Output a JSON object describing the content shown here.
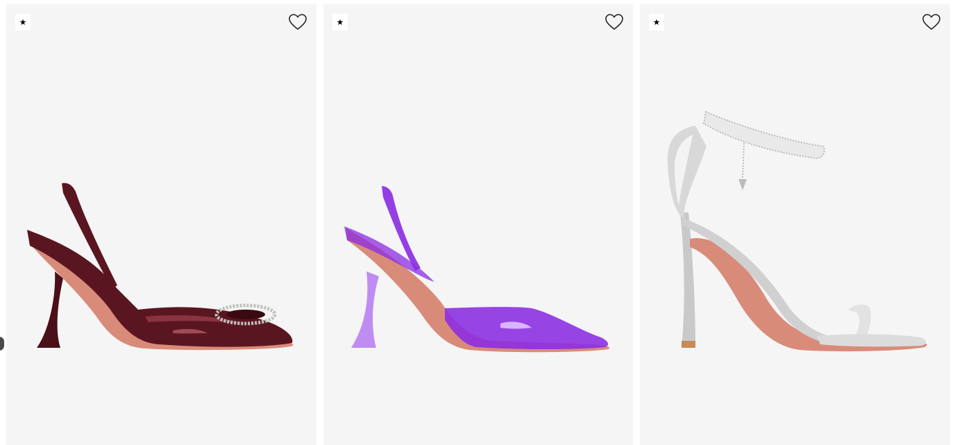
{
  "products": [
    {
      "badge_icon": "star-icon",
      "badge_text": "★",
      "wishlist_icon": "heart-outline-icon",
      "image": "burgundy-slingback-pump-with-crystal-buckle",
      "colors": {
        "upper": "#5a1620",
        "highlight": "#8a3440",
        "sole": "#d98b7a"
      }
    },
    {
      "badge_icon": "star-icon",
      "badge_text": "★",
      "wishlist_icon": "heart-outline-icon",
      "image": "purple-pvc-slingback-pump",
      "colors": {
        "upper": "#8a2be2",
        "highlight": "#b57af0",
        "sole": "#d98b7a"
      }
    },
    {
      "badge_icon": "star-icon",
      "badge_text": "★",
      "wishlist_icon": "heart-outline-icon",
      "image": "silver-sandal-with-crystal-ankle-strap",
      "colors": {
        "upper": "#cfcfcf",
        "highlight": "#f2f2f2",
        "sole": "#d98b7a"
      }
    }
  ],
  "carousel": {
    "prev_icon": "chevron-left-icon"
  }
}
